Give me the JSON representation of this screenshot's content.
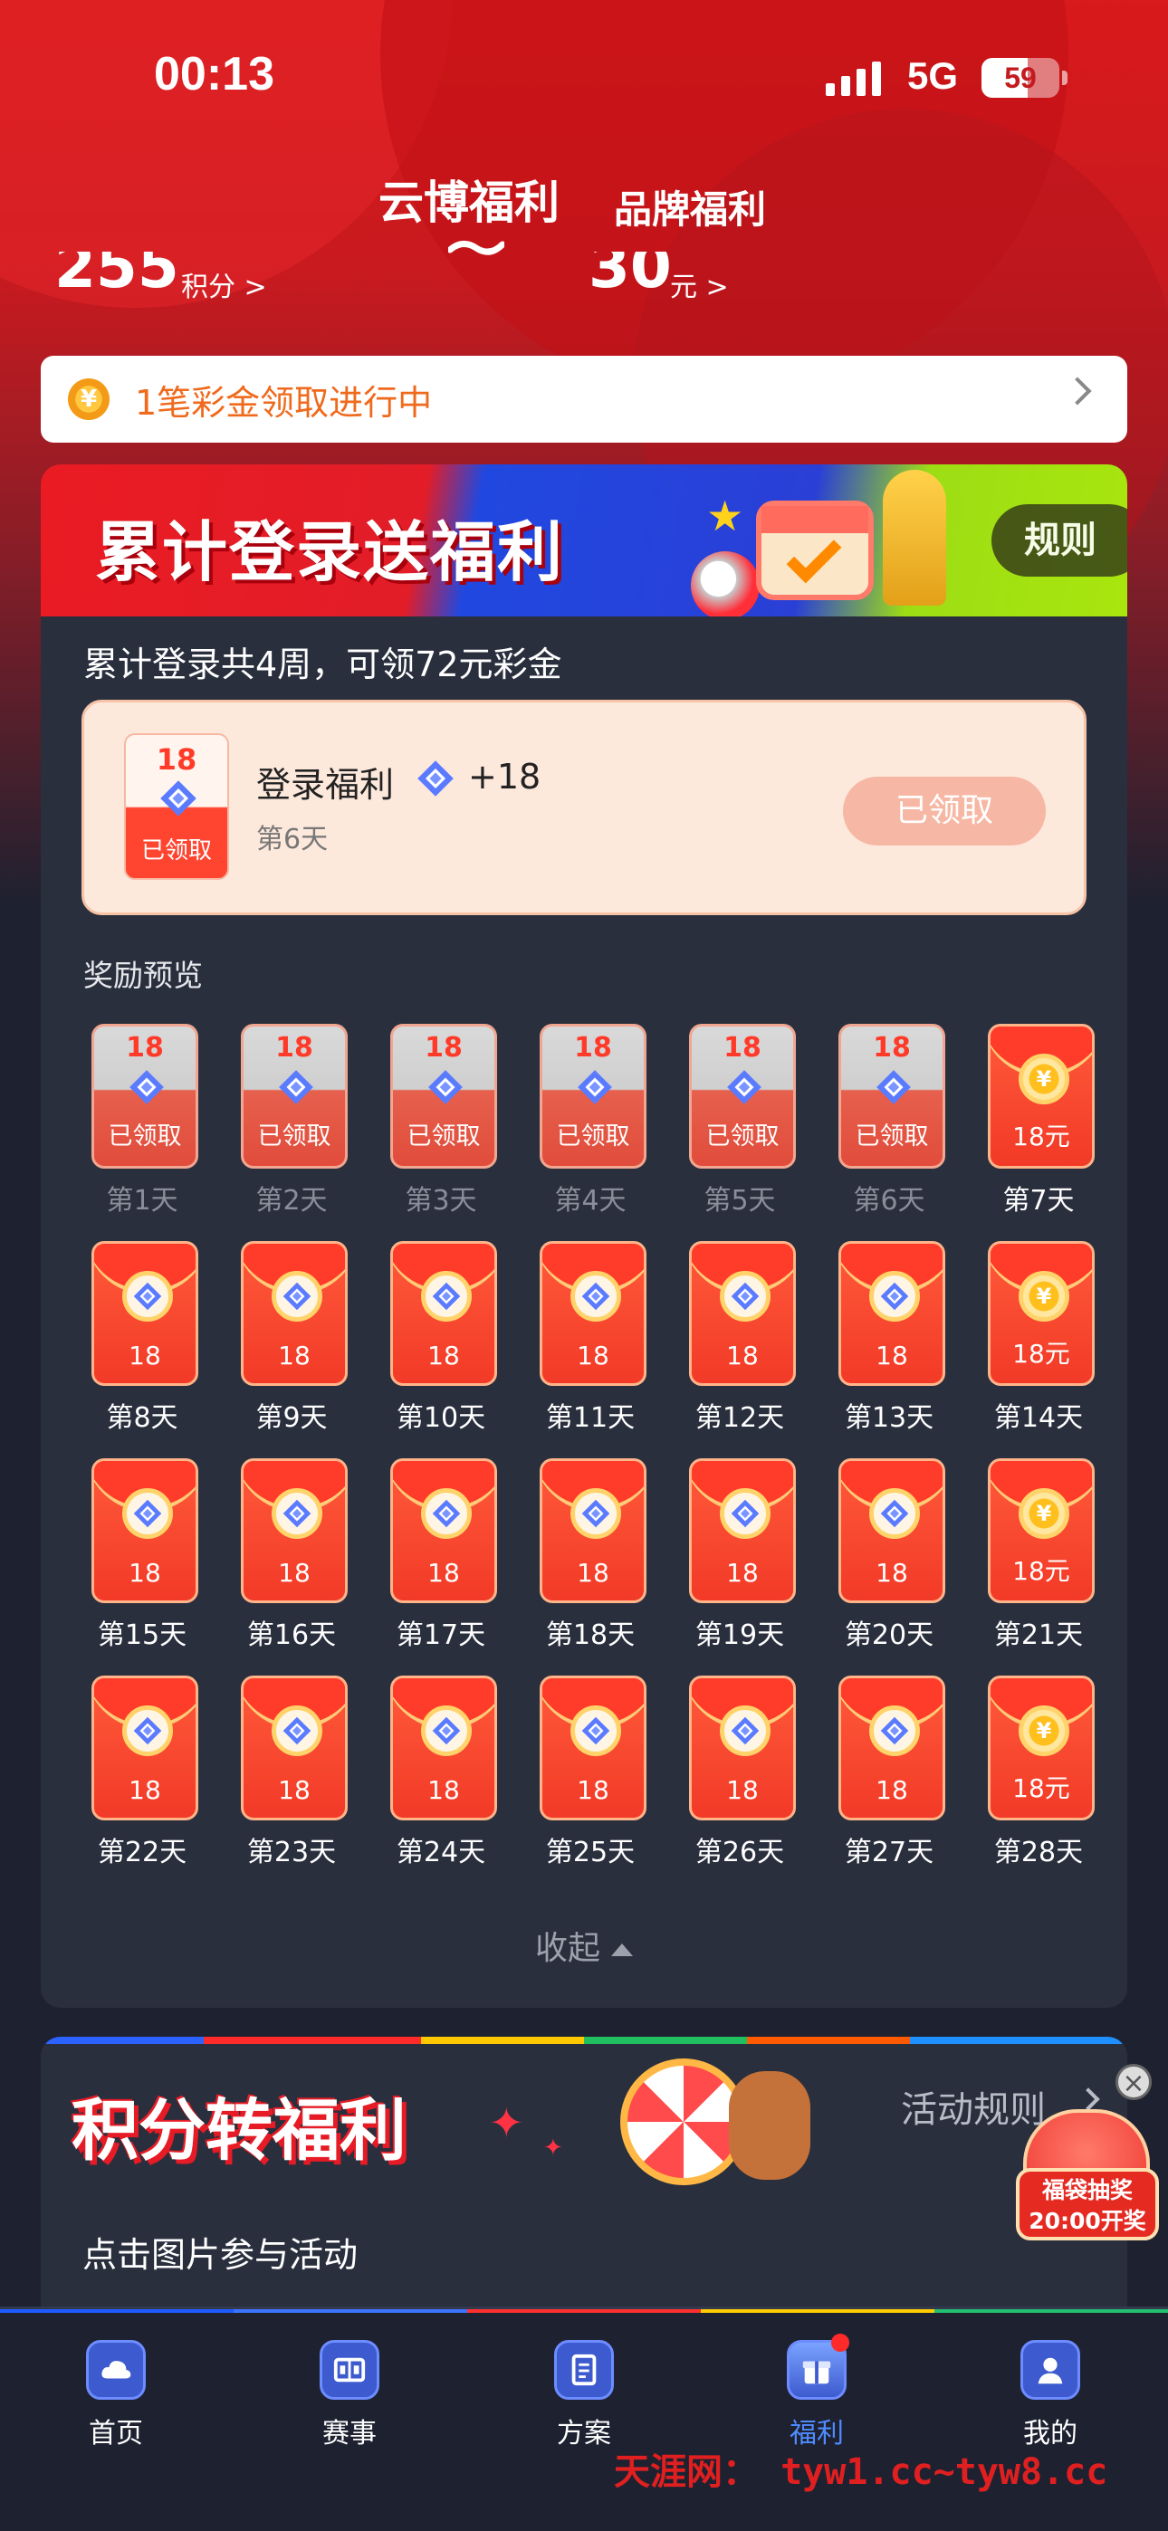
{
  "status_bar": {
    "time": "00:13",
    "network": "5G",
    "battery": "59",
    "battery_level": 0.59
  },
  "header": {
    "tabs": [
      {
        "label": "云博福利"
      },
      {
        "label": "品牌福利"
      }
    ],
    "peek": {
      "points_value": "255",
      "points_unit": "积分 >",
      "cash_value": "30",
      "cash_unit": "元 >"
    }
  },
  "notice": {
    "coin": "¥",
    "text": "1笔彩金领取进行中"
  },
  "login_card": {
    "banner_title": "累计登录送福利",
    "rules_label": "规则",
    "summary": "累计登录共4周，可领72元彩金",
    "today": {
      "env_value": "18",
      "env_status": "已领取",
      "title": "登录福利",
      "plus": "+18",
      "day": "第6天",
      "button": "已领取"
    },
    "preview_title": "奖励预览",
    "collapse_label": "收起",
    "days": [
      {
        "label": "第1天",
        "value": "18",
        "status": "已领取",
        "claimed": true,
        "cash": false
      },
      {
        "label": "第2天",
        "value": "18",
        "status": "已领取",
        "claimed": true,
        "cash": false
      },
      {
        "label": "第3天",
        "value": "18",
        "status": "已领取",
        "claimed": true,
        "cash": false
      },
      {
        "label": "第4天",
        "value": "18",
        "status": "已领取",
        "claimed": true,
        "cash": false
      },
      {
        "label": "第5天",
        "value": "18",
        "status": "已领取",
        "claimed": true,
        "cash": false
      },
      {
        "label": "第6天",
        "value": "18",
        "status": "已领取",
        "claimed": true,
        "cash": false
      },
      {
        "label": "第7天",
        "value": "18元",
        "claimed": false,
        "cash": true
      },
      {
        "label": "第8天",
        "value": "18",
        "claimed": false,
        "cash": false
      },
      {
        "label": "第9天",
        "value": "18",
        "claimed": false,
        "cash": false
      },
      {
        "label": "第10天",
        "value": "18",
        "claimed": false,
        "cash": false
      },
      {
        "label": "第11天",
        "value": "18",
        "claimed": false,
        "cash": false
      },
      {
        "label": "第12天",
        "value": "18",
        "claimed": false,
        "cash": false
      },
      {
        "label": "第13天",
        "value": "18",
        "claimed": false,
        "cash": false
      },
      {
        "label": "第14天",
        "value": "18元",
        "claimed": false,
        "cash": true
      },
      {
        "label": "第15天",
        "value": "18",
        "claimed": false,
        "cash": false
      },
      {
        "label": "第16天",
        "value": "18",
        "claimed": false,
        "cash": false
      },
      {
        "label": "第17天",
        "value": "18",
        "claimed": false,
        "cash": false
      },
      {
        "label": "第18天",
        "value": "18",
        "claimed": false,
        "cash": false
      },
      {
        "label": "第19天",
        "value": "18",
        "claimed": false,
        "cash": false
      },
      {
        "label": "第20天",
        "value": "18",
        "claimed": false,
        "cash": false
      },
      {
        "label": "第21天",
        "value": "18元",
        "claimed": false,
        "cash": true
      },
      {
        "label": "第22天",
        "value": "18",
        "claimed": false,
        "cash": false
      },
      {
        "label": "第23天",
        "value": "18",
        "claimed": false,
        "cash": false
      },
      {
        "label": "第24天",
        "value": "18",
        "claimed": false,
        "cash": false
      },
      {
        "label": "第25天",
        "value": "18",
        "claimed": false,
        "cash": false
      },
      {
        "label": "第26天",
        "value": "18",
        "claimed": false,
        "cash": false
      },
      {
        "label": "第27天",
        "value": "18",
        "claimed": false,
        "cash": false
      },
      {
        "label": "第28天",
        "value": "18元",
        "claimed": false,
        "cash": true
      }
    ]
  },
  "points_card": {
    "banner_title": "积分转福利",
    "rules_label": "活动规则",
    "cta": "点击图片参与活动"
  },
  "float_badge": {
    "close": "×",
    "line1": "福袋抽奖",
    "line2": "20:00开奖"
  },
  "nav": {
    "items": [
      {
        "label": "首页",
        "icon": "cloud-icon"
      },
      {
        "label": "赛事",
        "icon": "scoreboard-icon"
      },
      {
        "label": "方案",
        "icon": "document-icon"
      },
      {
        "label": "福利",
        "icon": "gift-icon",
        "active": true
      },
      {
        "label": "我的",
        "icon": "user-icon"
      }
    ]
  },
  "watermark": "天涯网： tyw1.cc~tyw8.cc",
  "colors": {
    "brand_red": "#d9191c",
    "accent_orange": "#ef6a1d",
    "active_blue": "#4f8bff",
    "card_bg": "#2a2f3e"
  }
}
